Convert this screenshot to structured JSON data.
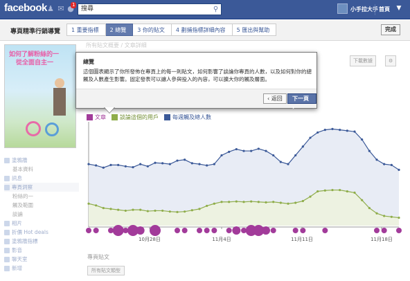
{
  "app": {
    "logo": "facebook",
    "search_value": "搜尋",
    "username": "小手拉大手",
    "home": "首頁",
    "notif_count": "1"
  },
  "guide": {
    "title": "專頁精準行銷導覽",
    "steps": [
      "1 重要指標",
      "2 總覽",
      "3 你的貼文",
      "4 劃捕指標詳細內容",
      "5 匯出與幫助"
    ],
    "active_step": 1,
    "finish": "完成"
  },
  "sidebar": {
    "cover_text": [
      "如何了解粉絲的一",
      "從全面自主一"
    ],
    "items": [
      {
        "label": "塗鴉牆",
        "sub": false
      },
      {
        "label": "基本資料",
        "sub": true
      },
      {
        "label": "訊息",
        "sub": false
      },
      {
        "label": "專頁洞察",
        "sub": false,
        "hl": true
      },
      {
        "label": "粉絲的一",
        "sub": true
      },
      {
        "label": "觸及範圍",
        "sub": true
      },
      {
        "label": "談論",
        "sub": true
      },
      {
        "label": "相片",
        "sub": false
      },
      {
        "label": "折價 Hot deals",
        "sub": false
      },
      {
        "label": "塗鴉牆指標",
        "sub": false
      },
      {
        "label": "影音",
        "sub": false
      },
      {
        "label": "聊天室",
        "sub": false
      },
      {
        "label": "新增",
        "sub": false
      }
    ]
  },
  "background": {
    "tabs": "所有貼文概要 / 文章詳細",
    "export_btn": "下載數據",
    "posts_title": "專頁貼文",
    "posts_select": "所有貼文類型"
  },
  "popup": {
    "title": "總覽",
    "body": "這個圖表顯示了你所發佈在專頁上的每一則貼文，如何影響了談論你專頁的人數，以及如何對你的總觸及人數產生影響。固定發表可以讓人參與投入的內容，可以擴大你的觸及層面。",
    "back": "返回",
    "next": "下一頁",
    "close": "×"
  },
  "chart_data": {
    "type": "line",
    "x_tick_labels": [
      "10月28日",
      "11月4日",
      "11月11日",
      "11月18日"
    ],
    "series": [
      {
        "name": "每週觸及總人數",
        "color": "#3b5998",
        "values": [
          240,
          237,
          232,
          238,
          238,
          235,
          233,
          240,
          235,
          243,
          242,
          240,
          248,
          250,
          242,
          240,
          237,
          240,
          260,
          268,
          274,
          270,
          270,
          275,
          270,
          260,
          245,
          240,
          260,
          280,
          300,
          312,
          318,
          320,
          318,
          316,
          314,
          296,
          270,
          250,
          240,
          238,
          227
        ]
      },
      {
        "name": "談論這個的用戶",
        "color": "#8fad4a",
        "values": [
          150,
          146,
          140,
          138,
          136,
          134,
          136,
          136,
          133,
          134,
          134,
          132,
          131,
          132,
          135,
          138,
          145,
          150,
          154,
          154,
          155,
          154,
          155,
          154,
          153,
          154,
          152,
          150,
          152,
          156,
          166,
          178,
          180,
          181,
          181,
          178,
          175,
          158,
          140,
          128,
          122,
          120,
          118
        ]
      },
      {
        "name": "文章",
        "color": "#a23b9a",
        "bubbles": [
          4,
          4,
          0,
          4,
          8,
          4,
          8,
          6,
          0,
          8,
          0,
          0,
          4,
          4,
          0,
          4,
          4,
          4,
          0,
          4,
          6,
          4,
          8,
          8,
          6,
          4,
          0,
          0,
          4,
          4,
          0,
          0,
          4,
          0,
          0,
          0,
          0,
          0,
          0,
          4,
          4,
          0,
          4
        ]
      }
    ],
    "ylim": [
      100,
      330
    ]
  }
}
